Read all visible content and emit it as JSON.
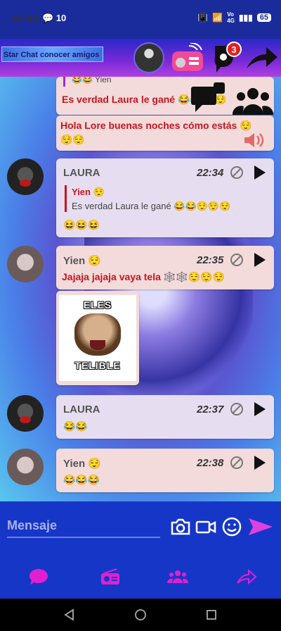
{
  "status_bar": {
    "time": "22:43",
    "notif_count": "10",
    "network": "VoLTE 4G",
    "battery": "65"
  },
  "header": {
    "app_title": "Star Chat conocer amigos",
    "notification_count": "3"
  },
  "icons": {
    "radio": "radio-icon",
    "notification": "notification-icon",
    "share": "share-icon",
    "chat": "chat-icon",
    "group": "group-icon",
    "speaker": "speaker-icon",
    "camera": "camera-icon",
    "video": "video-icon",
    "emoji": "emoji-icon",
    "send": "send-icon"
  },
  "colors": {
    "accent": "#c8141e",
    "composer_bg": "#1636c8",
    "send": "#e040e0",
    "nav_icon": "#e020d0"
  },
  "messages": [
    {
      "id": "top",
      "quote_name": "Yien",
      "quote_emojis": "😂😂",
      "text": "Es verdad Laura le gané 😂😂😌😌"
    },
    {
      "id": "hola",
      "text": "Hola Lore buenas noches cómo estás 😌",
      "text2": "😌😌"
    },
    {
      "id": "laura1",
      "sender": "LAURA",
      "time": "22:34",
      "quote_name": "Yien 😌",
      "quote_text": "Es verdad Laura le gané 😂😂😌😌😌",
      "text": "😆😆😆"
    },
    {
      "id": "yien1",
      "sender": "Yien 😌",
      "time": "22:35",
      "text": "Jajaja jajaja vaya tela 🕸️🕸️😌😌😌"
    },
    {
      "id": "meme",
      "meme_top": "ELES",
      "meme_bottom": "TELIBLE"
    },
    {
      "id": "laura2",
      "sender": "LAURA",
      "time": "22:37",
      "text": "😂😂"
    },
    {
      "id": "yien2",
      "sender": "Yien 😌",
      "time": "22:38",
      "text": "😂😂😂"
    }
  ],
  "composer": {
    "placeholder": "Mensaje"
  },
  "bottom_nav": [
    "chat-nav-icon",
    "radio-nav-icon",
    "group-nav-icon",
    "share-nav-icon"
  ]
}
